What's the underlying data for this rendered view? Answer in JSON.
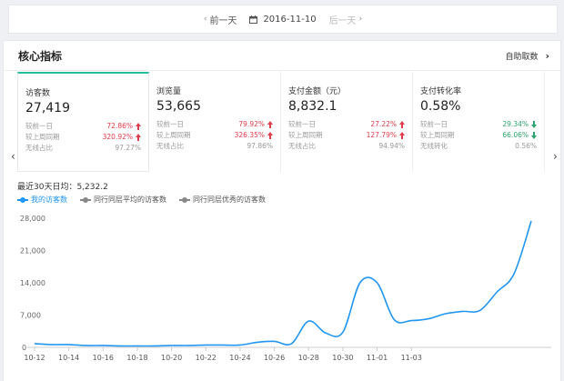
{
  "datebar": {
    "prev_label": "前一天",
    "date": "2016-11-10",
    "next_label": "后一天"
  },
  "panel": {
    "title": "核心指标",
    "custom_label": "自助取数"
  },
  "cards": [
    {
      "name": "访客数",
      "value": "27,419",
      "rows": [
        {
          "label": "较前一日",
          "value": "72.86%",
          "trend": "up"
        },
        {
          "label": "较上周同期",
          "value": "320.92%",
          "trend": "up"
        },
        {
          "label": "无线占比",
          "value": "97.27%",
          "trend": "none"
        }
      ]
    },
    {
      "name": "浏览量",
      "value": "53,665",
      "rows": [
        {
          "label": "较前一日",
          "value": "79.92%",
          "trend": "up"
        },
        {
          "label": "较上周同期",
          "value": "326.35%",
          "trend": "up"
        },
        {
          "label": "无线占比",
          "value": "97.86%",
          "trend": "none"
        }
      ]
    },
    {
      "name": "支付金额（元）",
      "value": "8,832.1",
      "rows": [
        {
          "label": "较前一日",
          "value": "27.22%",
          "trend": "up"
        },
        {
          "label": "较上周同期",
          "value": "127.79%",
          "trend": "up"
        },
        {
          "label": "无线占比",
          "value": "94.94%",
          "trend": "none"
        }
      ]
    },
    {
      "name": "支付转化率",
      "value": "0.58%",
      "rows": [
        {
          "label": "较前一日",
          "value": "29.34%",
          "trend": "down"
        },
        {
          "label": "较上周同期",
          "value": "66.06%",
          "trend": "down"
        },
        {
          "label": "无线转化",
          "value": "0.56%",
          "trend": "none"
        }
      ]
    }
  ],
  "avg_text": "最近30天日均：5,232.2",
  "legend": [
    "我的访客数",
    "同行同层平均的访客数",
    "同行同层优秀的访客数"
  ],
  "colors": {
    "accent": "#2196f3",
    "up": "#e23b4a",
    "down": "#2aa36e",
    "active_border": "#20c0a0"
  },
  "chart_data": {
    "type": "line",
    "ylim": [
      0,
      28000
    ],
    "yticks": [
      "0",
      "7,000",
      "14,000",
      "21,000",
      "28,000"
    ],
    "x_ticks": [
      "10-12",
      "10-14",
      "10-16",
      "10-18",
      "10-20",
      "10-22",
      "10-24",
      "10-26",
      "10-28",
      "10-30",
      "11-01",
      "11-03"
    ],
    "series": [
      {
        "name": "我的访客数",
        "x": [
          "10-12",
          "10-13",
          "10-14",
          "10-15",
          "10-16",
          "10-17",
          "10-18",
          "10-19",
          "10-20",
          "10-21",
          "10-22",
          "10-23",
          "10-24",
          "10-25",
          "10-26",
          "10-27",
          "10-28",
          "10-29",
          "10-30",
          "10-31",
          "11-01",
          "11-02",
          "11-03",
          "11-04",
          "11-05",
          "11-06",
          "11-07",
          "11-08",
          "11-09",
          "11-10"
        ],
        "values": [
          800,
          600,
          600,
          400,
          400,
          300,
          300,
          300,
          400,
          400,
          500,
          500,
          500,
          1100,
          1300,
          800,
          5700,
          3100,
          3300,
          14000,
          14000,
          6000,
          5800,
          6200,
          7300,
          7800,
          8000,
          12000,
          16000,
          27419
        ]
      }
    ]
  }
}
